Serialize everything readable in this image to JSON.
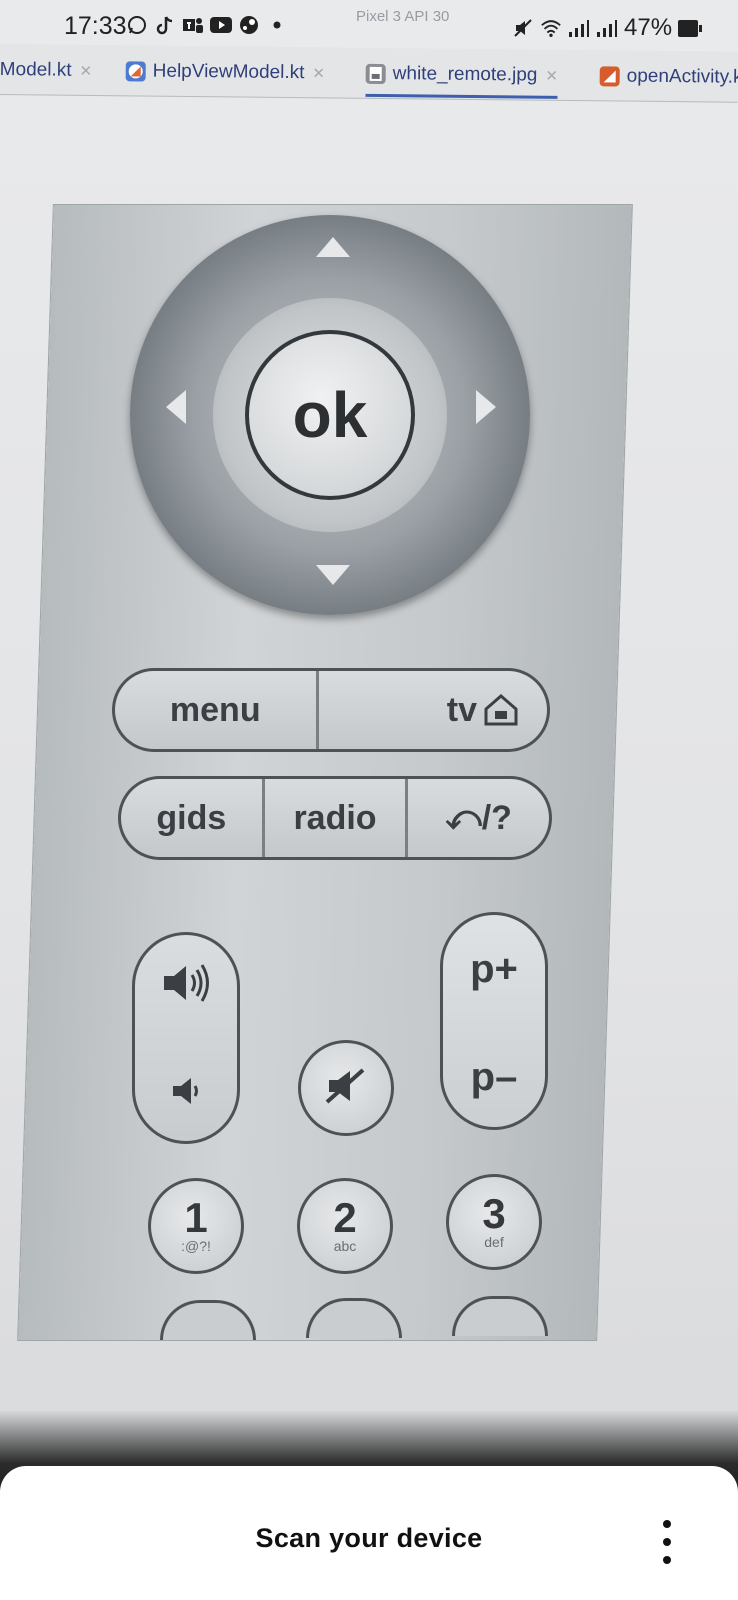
{
  "status_bar": {
    "time": "17:33",
    "battery": "47%",
    "icons": [
      "whatsapp-icon",
      "tiktok-icon",
      "teams-icon",
      "youtube-icon",
      "steam-icon",
      "dot-icon",
      "mute-icon",
      "wifi-icon",
      "signal-icon",
      "signal-icon",
      "battery-icon"
    ]
  },
  "ide": {
    "emulator_label": "Pixel 3 API 30",
    "tabs": [
      {
        "label": "Model.kt"
      },
      {
        "label": "HelpViewModel.kt"
      },
      {
        "label": "white_remote.jpg",
        "active": true
      },
      {
        "label": "openActivity.k"
      }
    ]
  },
  "remote": {
    "ok_label": "ok",
    "row1": [
      "menu",
      "tv"
    ],
    "row2": [
      "gids",
      "radio",
      "⤺/?"
    ],
    "channel_up": "p+",
    "channel_down": "p–",
    "numbers": [
      {
        "digit": "1",
        "letters": ":@?!"
      },
      {
        "digit": "2",
        "letters": "abc"
      },
      {
        "digit": "3",
        "letters": "def"
      }
    ]
  },
  "bottom_sheet": {
    "title": "Scan your device"
  },
  "colors": {
    "tab_text": "#2e3f7a",
    "active_tab_underline": "#3d5fae"
  }
}
